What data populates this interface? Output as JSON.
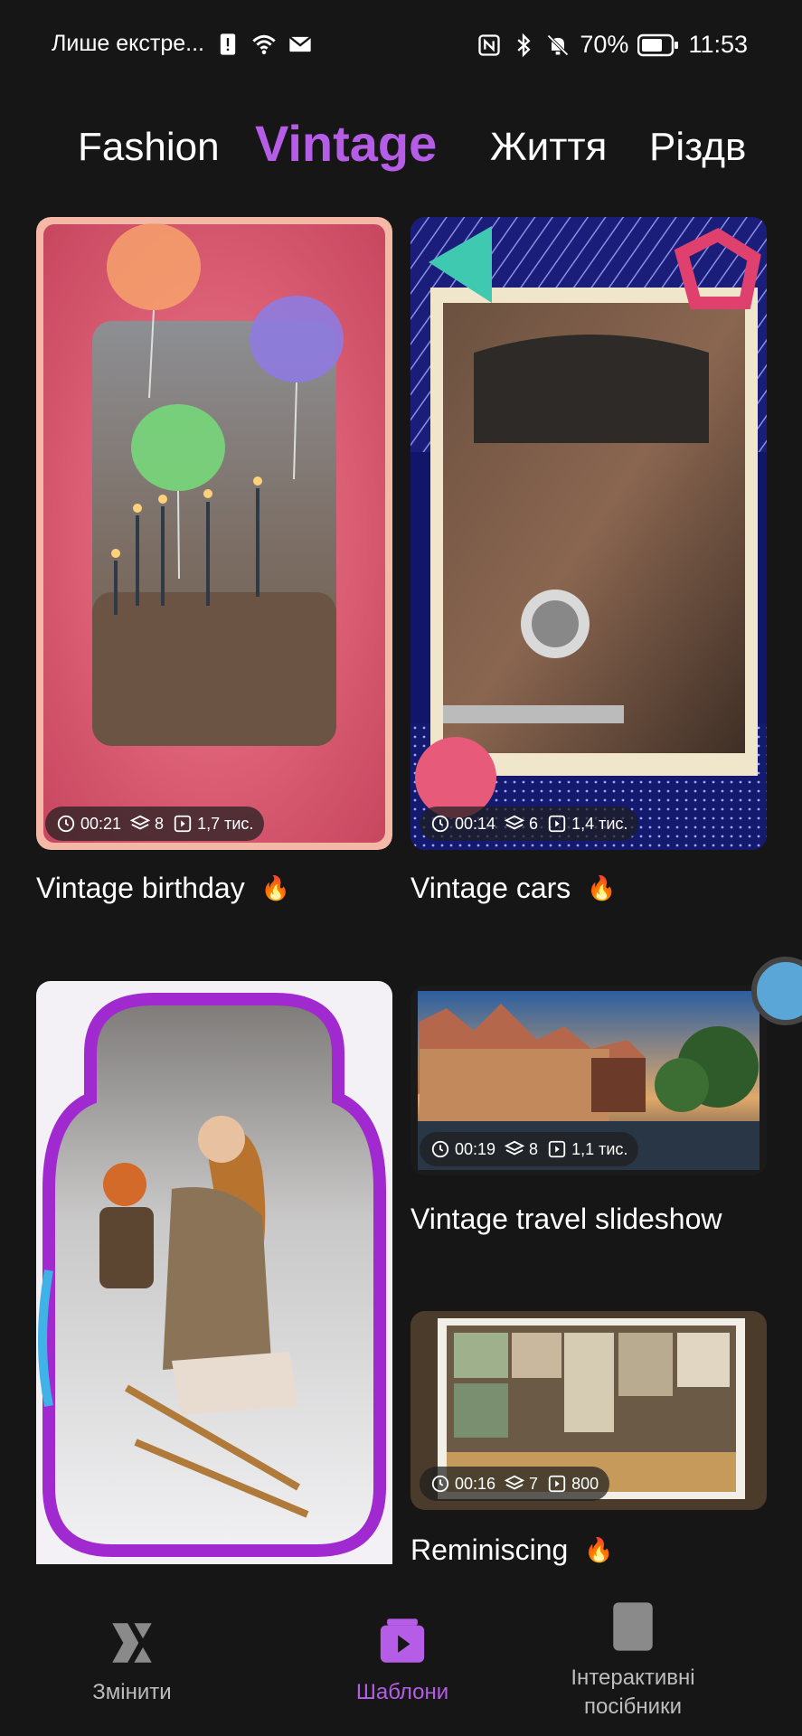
{
  "status_bar": {
    "carrier": "Лише екстре...",
    "battery": "70%",
    "time": "11:53"
  },
  "tabs": [
    {
      "label": "Fashion",
      "active": false
    },
    {
      "label": "Vintage",
      "active": true
    },
    {
      "label": "Життя",
      "active": false
    },
    {
      "label": "Різдв",
      "active": false
    }
  ],
  "templates": [
    {
      "title": "Vintage birthday",
      "duration": "00:21",
      "layers": "8",
      "uses": "1,7 тис.",
      "hot": true
    },
    {
      "title": "Vintage cars",
      "duration": "00:14",
      "layers": "6",
      "uses": "1,4 тис.",
      "hot": true
    },
    {
      "title": "",
      "duration": "",
      "layers": "",
      "uses": "",
      "hot": false
    },
    {
      "title": "Vintage travel slideshow",
      "duration": "00:19",
      "layers": "8",
      "uses": "1,1 тис.",
      "hot": false
    },
    {
      "title": "Reminiscing",
      "duration": "00:16",
      "layers": "7",
      "uses": "800",
      "hot": true
    }
  ],
  "bottom_nav": [
    {
      "label": "Змінити",
      "icon": "edit-icon",
      "active": false
    },
    {
      "label": "Шаблони",
      "icon": "templates-icon",
      "active": true
    },
    {
      "label": "Інтерактивні посібники",
      "icon": "guides-icon",
      "active": false
    }
  ],
  "colors": {
    "accent": "#b65de8",
    "background": "#161616"
  }
}
